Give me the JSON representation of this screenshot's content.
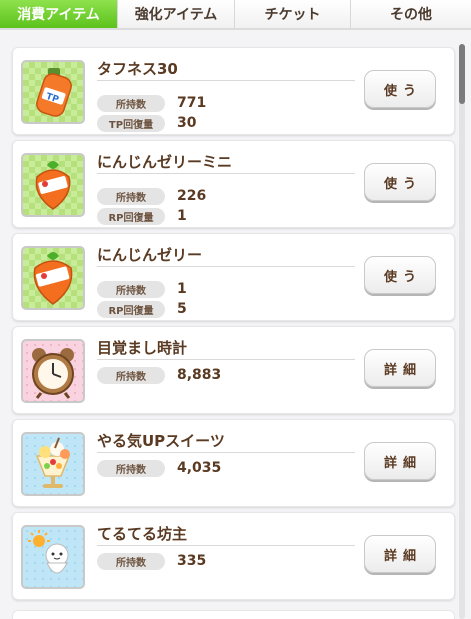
{
  "tabs": [
    {
      "label": "消費アイテム",
      "active": true
    },
    {
      "label": "強化アイテム",
      "active": false
    },
    {
      "label": "チケット",
      "active": false
    },
    {
      "label": "その他",
      "active": false
    }
  ],
  "items": [
    {
      "name": "タフネス30",
      "icon": "tp-drink-bottle-icon",
      "stats": [
        {
          "label": "所持数",
          "value": "771"
        },
        {
          "label": "TP回復量",
          "value": "30"
        }
      ],
      "button": "使う"
    },
    {
      "name": "にんじんゼリーミニ",
      "icon": "carrot-jelly-mini-icon",
      "stats": [
        {
          "label": "所持数",
          "value": "226"
        },
        {
          "label": "RP回復量",
          "value": "1"
        }
      ],
      "button": "使う"
    },
    {
      "name": "にんじんゼリー",
      "icon": "carrot-jelly-icon",
      "stats": [
        {
          "label": "所持数",
          "value": "1"
        },
        {
          "label": "RP回復量",
          "value": "5"
        }
      ],
      "button": "使う"
    },
    {
      "name": "目覚まし時計",
      "icon": "alarm-clock-icon",
      "stats": [
        {
          "label": "所持数",
          "value": "8,883"
        }
      ],
      "button": "詳細"
    },
    {
      "name": "やる気UPスイーツ",
      "icon": "parfait-icon",
      "stats": [
        {
          "label": "所持数",
          "value": "4,035"
        }
      ],
      "button": "詳細"
    },
    {
      "name": "てるてる坊主",
      "icon": "teru-teru-bozu-icon",
      "stats": [
        {
          "label": "所持数",
          "value": "335"
        }
      ],
      "button": "詳細"
    }
  ],
  "colors": {
    "tab_active": "#6bd12a",
    "text_brown": "#5a3a22",
    "label_gray": "#e4e4e4"
  }
}
